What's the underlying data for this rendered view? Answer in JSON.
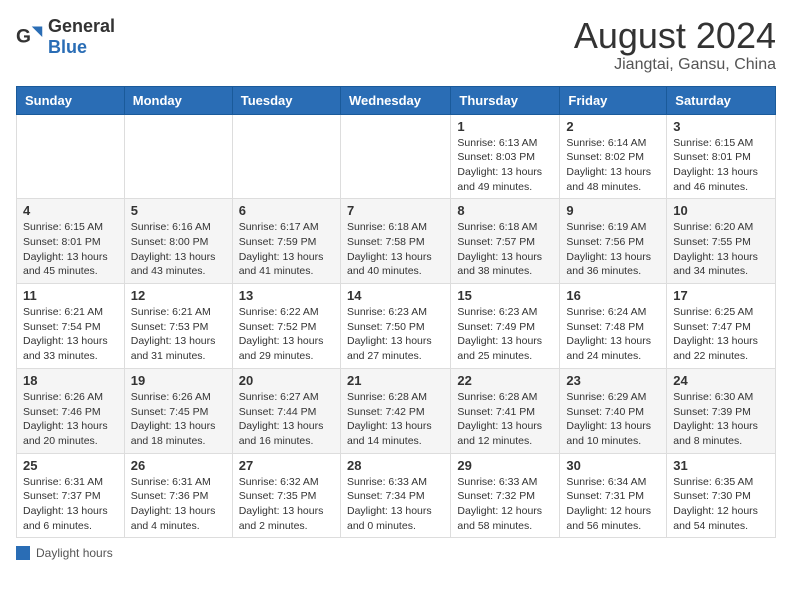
{
  "logo": {
    "general": "General",
    "blue": "Blue"
  },
  "title": "August 2024",
  "subtitle": "Jiangtai, Gansu, China",
  "weekdays": [
    "Sunday",
    "Monday",
    "Tuesday",
    "Wednesday",
    "Thursday",
    "Friday",
    "Saturday"
  ],
  "legend_text": "Daylight hours",
  "weeks": [
    [
      {
        "day": "",
        "info": ""
      },
      {
        "day": "",
        "info": ""
      },
      {
        "day": "",
        "info": ""
      },
      {
        "day": "",
        "info": ""
      },
      {
        "day": "1",
        "info": "Sunrise: 6:13 AM\nSunset: 8:03 PM\nDaylight: 13 hours and 49 minutes."
      },
      {
        "day": "2",
        "info": "Sunrise: 6:14 AM\nSunset: 8:02 PM\nDaylight: 13 hours and 48 minutes."
      },
      {
        "day": "3",
        "info": "Sunrise: 6:15 AM\nSunset: 8:01 PM\nDaylight: 13 hours and 46 minutes."
      }
    ],
    [
      {
        "day": "4",
        "info": "Sunrise: 6:15 AM\nSunset: 8:01 PM\nDaylight: 13 hours and 45 minutes."
      },
      {
        "day": "5",
        "info": "Sunrise: 6:16 AM\nSunset: 8:00 PM\nDaylight: 13 hours and 43 minutes."
      },
      {
        "day": "6",
        "info": "Sunrise: 6:17 AM\nSunset: 7:59 PM\nDaylight: 13 hours and 41 minutes."
      },
      {
        "day": "7",
        "info": "Sunrise: 6:18 AM\nSunset: 7:58 PM\nDaylight: 13 hours and 40 minutes."
      },
      {
        "day": "8",
        "info": "Sunrise: 6:18 AM\nSunset: 7:57 PM\nDaylight: 13 hours and 38 minutes."
      },
      {
        "day": "9",
        "info": "Sunrise: 6:19 AM\nSunset: 7:56 PM\nDaylight: 13 hours and 36 minutes."
      },
      {
        "day": "10",
        "info": "Sunrise: 6:20 AM\nSunset: 7:55 PM\nDaylight: 13 hours and 34 minutes."
      }
    ],
    [
      {
        "day": "11",
        "info": "Sunrise: 6:21 AM\nSunset: 7:54 PM\nDaylight: 13 hours and 33 minutes."
      },
      {
        "day": "12",
        "info": "Sunrise: 6:21 AM\nSunset: 7:53 PM\nDaylight: 13 hours and 31 minutes."
      },
      {
        "day": "13",
        "info": "Sunrise: 6:22 AM\nSunset: 7:52 PM\nDaylight: 13 hours and 29 minutes."
      },
      {
        "day": "14",
        "info": "Sunrise: 6:23 AM\nSunset: 7:50 PM\nDaylight: 13 hours and 27 minutes."
      },
      {
        "day": "15",
        "info": "Sunrise: 6:23 AM\nSunset: 7:49 PM\nDaylight: 13 hours and 25 minutes."
      },
      {
        "day": "16",
        "info": "Sunrise: 6:24 AM\nSunset: 7:48 PM\nDaylight: 13 hours and 24 minutes."
      },
      {
        "day": "17",
        "info": "Sunrise: 6:25 AM\nSunset: 7:47 PM\nDaylight: 13 hours and 22 minutes."
      }
    ],
    [
      {
        "day": "18",
        "info": "Sunrise: 6:26 AM\nSunset: 7:46 PM\nDaylight: 13 hours and 20 minutes."
      },
      {
        "day": "19",
        "info": "Sunrise: 6:26 AM\nSunset: 7:45 PM\nDaylight: 13 hours and 18 minutes."
      },
      {
        "day": "20",
        "info": "Sunrise: 6:27 AM\nSunset: 7:44 PM\nDaylight: 13 hours and 16 minutes."
      },
      {
        "day": "21",
        "info": "Sunrise: 6:28 AM\nSunset: 7:42 PM\nDaylight: 13 hours and 14 minutes."
      },
      {
        "day": "22",
        "info": "Sunrise: 6:28 AM\nSunset: 7:41 PM\nDaylight: 13 hours and 12 minutes."
      },
      {
        "day": "23",
        "info": "Sunrise: 6:29 AM\nSunset: 7:40 PM\nDaylight: 13 hours and 10 minutes."
      },
      {
        "day": "24",
        "info": "Sunrise: 6:30 AM\nSunset: 7:39 PM\nDaylight: 13 hours and 8 minutes."
      }
    ],
    [
      {
        "day": "25",
        "info": "Sunrise: 6:31 AM\nSunset: 7:37 PM\nDaylight: 13 hours and 6 minutes."
      },
      {
        "day": "26",
        "info": "Sunrise: 6:31 AM\nSunset: 7:36 PM\nDaylight: 13 hours and 4 minutes."
      },
      {
        "day": "27",
        "info": "Sunrise: 6:32 AM\nSunset: 7:35 PM\nDaylight: 13 hours and 2 minutes."
      },
      {
        "day": "28",
        "info": "Sunrise: 6:33 AM\nSunset: 7:34 PM\nDaylight: 13 hours and 0 minutes."
      },
      {
        "day": "29",
        "info": "Sunrise: 6:33 AM\nSunset: 7:32 PM\nDaylight: 12 hours and 58 minutes."
      },
      {
        "day": "30",
        "info": "Sunrise: 6:34 AM\nSunset: 7:31 PM\nDaylight: 12 hours and 56 minutes."
      },
      {
        "day": "31",
        "info": "Sunrise: 6:35 AM\nSunset: 7:30 PM\nDaylight: 12 hours and 54 minutes."
      }
    ]
  ]
}
